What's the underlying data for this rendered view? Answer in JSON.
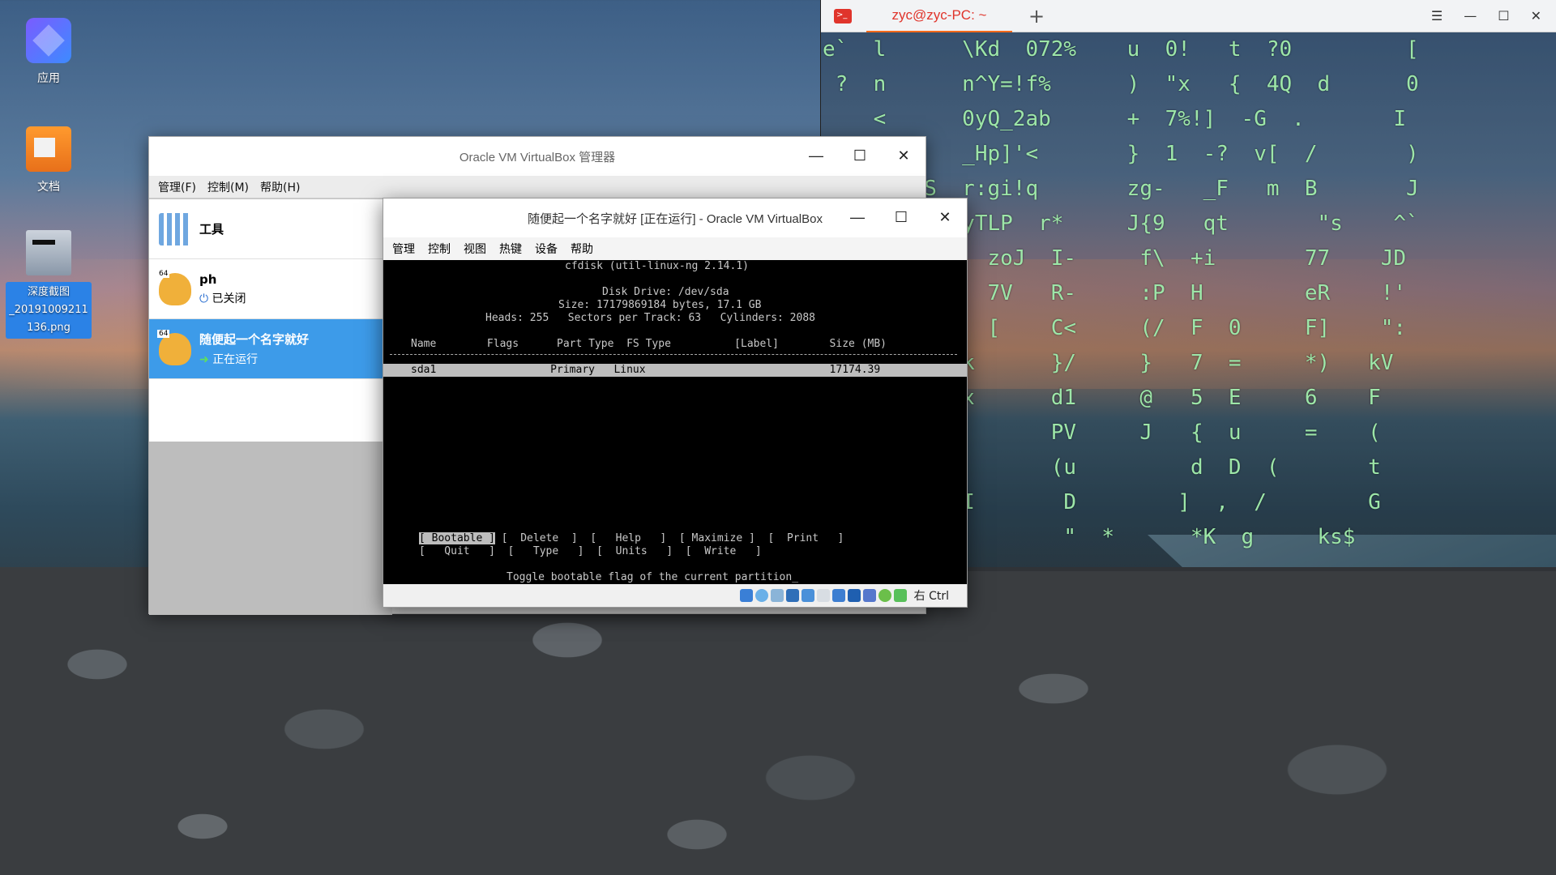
{
  "desktop": {
    "icons": [
      {
        "label": "应用",
        "icon": "apps-icon"
      },
      {
        "label": "文档",
        "icon": "folder-icon"
      },
      {
        "label": "深度截图\n_20191009211\n136.png",
        "icon": "image-file-icon"
      }
    ]
  },
  "terminal": {
    "tab_title": "zyc@zyc-PC: ~",
    "rain_lines": [
      "e`  l      \\Kd  072%    u  0!   t  ?0         [",
      " ?  n      n^Y=!f%      )  \"x   {  4Q  d      0",
      "    <      0yQ_2ab      +  7%!]  -G  .       I",
      "           _Hp]'<       }  1  -?  v[  /       )",
      "        S  r:gi!q       zg-   _F   m  B       J",
      "           yTLP  r*     J{9   qt       \"s    ^`",
      "             zoJ  I-     f\\  +i       77    JD",
      "             7V   R-     :P  H        eR    !'",
      "             [    C<     (/  F  0     F]    \":",
      "        v  k      }/     }   7  =     *)   kV",
      "        M  x      d1     @   5  E     6    F",
      "        p         PV     J   {  u     =    (",
      "        g@        (u         d  D  (       t",
      "           I       D        ]  ,  /        G",
      "        y          \"  *      *K  g     ks$"
    ]
  },
  "manager": {
    "title": "Oracle VM VirtualBox 管理器",
    "menu": [
      "管理(F)",
      "控制(M)",
      "帮助(H)"
    ],
    "tools_label": "工具",
    "vms": [
      {
        "name": "ph",
        "status": "已关闭"
      },
      {
        "name": "随便起一个名字就好",
        "status": "正在运行"
      }
    ]
  },
  "vm": {
    "title": "随便起一个名字就好 [正在运行] - Oracle VM VirtualBox",
    "menu": [
      "管理",
      "控制",
      "视图",
      "热键",
      "设备",
      "帮助"
    ],
    "console": {
      "header": "cfdisk (util-linux-ng 2.14.1)",
      "drive": "Disk Drive: /dev/sda",
      "size": "Size: 17179869184 bytes, 17.1 GB",
      "geometry": "Heads: 255   Sectors per Track: 63   Cylinders: 2088",
      "columns": "Name        Flags      Part Type  FS Type          [Label]        Size (MB)",
      "row": "sda1                  Primary   Linux                             17174.39",
      "menu_row1_sel": "[ Bootable ]",
      "menu_row1_rest": " [  Delete  ]  [   Help   ]  [ Maximize ]  [  Print   ]",
      "menu_row2": "[   Quit   ]  [   Type   ]  [  Units   ]  [  Write   ]",
      "hint": "Toggle bootable flag of the current partition_"
    },
    "host_key": "右 Ctrl"
  }
}
